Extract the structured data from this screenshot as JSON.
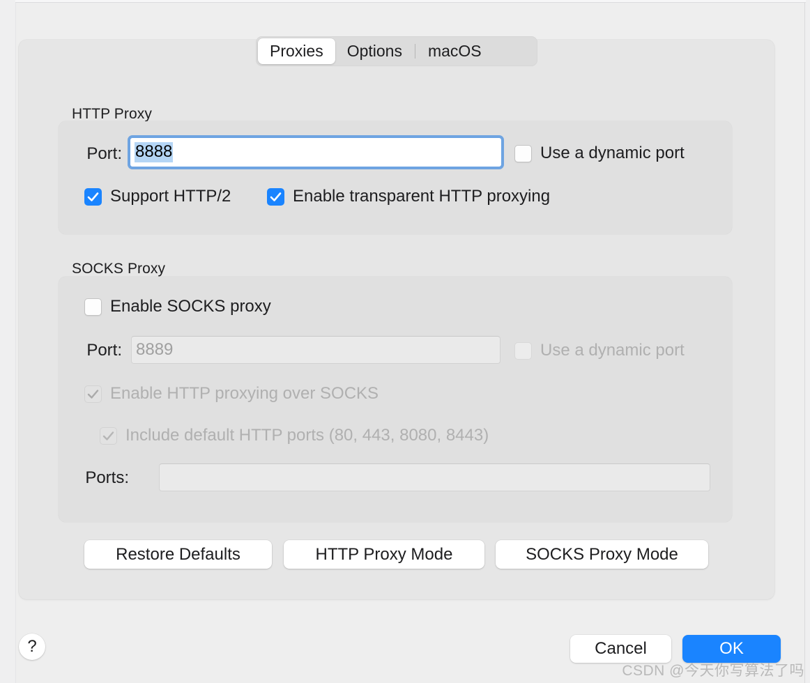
{
  "window": {
    "tabs": [
      {
        "label": "Proxies",
        "selected": true
      },
      {
        "label": "Options",
        "selected": false
      },
      {
        "label": "macOS",
        "selected": false
      }
    ]
  },
  "http_proxy": {
    "section_label": "HTTP Proxy",
    "port_label": "Port:",
    "port_value": "8888",
    "dynamic_port": {
      "label": "Use a dynamic port",
      "checked": false,
      "enabled": true
    },
    "support_http2": {
      "label": "Support HTTP/2",
      "checked": true,
      "enabled": true
    },
    "transparent_proxying": {
      "label": "Enable transparent HTTP proxying",
      "checked": true,
      "enabled": true
    }
  },
  "socks_proxy": {
    "section_label": "SOCKS Proxy",
    "enable": {
      "label": "Enable SOCKS proxy",
      "checked": false,
      "enabled": true
    },
    "port_label": "Port:",
    "port_value": "8889",
    "dynamic_port": {
      "label": "Use a dynamic port",
      "checked": false,
      "enabled": false
    },
    "http_over_socks": {
      "label": "Enable HTTP proxying over SOCKS",
      "checked": true,
      "enabled": false
    },
    "include_default_ports": {
      "label": "Include default HTTP ports (80, 443, 8080, 8443)",
      "checked": true,
      "enabled": false
    },
    "ports_label": "Ports:",
    "ports_value": ""
  },
  "actions": {
    "restore_defaults": "Restore Defaults",
    "http_proxy_mode": "HTTP Proxy Mode",
    "socks_proxy_mode": "SOCKS Proxy Mode"
  },
  "footer": {
    "help": "?",
    "cancel": "Cancel",
    "ok": "OK"
  },
  "watermark": "CSDN @今天你写算法了吗",
  "colors": {
    "accent": "#1a84ff",
    "selection": "#b4d5f5",
    "panel_bg": "#e6e6e6",
    "group_bg": "#e0e0e0",
    "window_bg": "#eeeeee",
    "disabled_text": "#b0b0b0"
  }
}
